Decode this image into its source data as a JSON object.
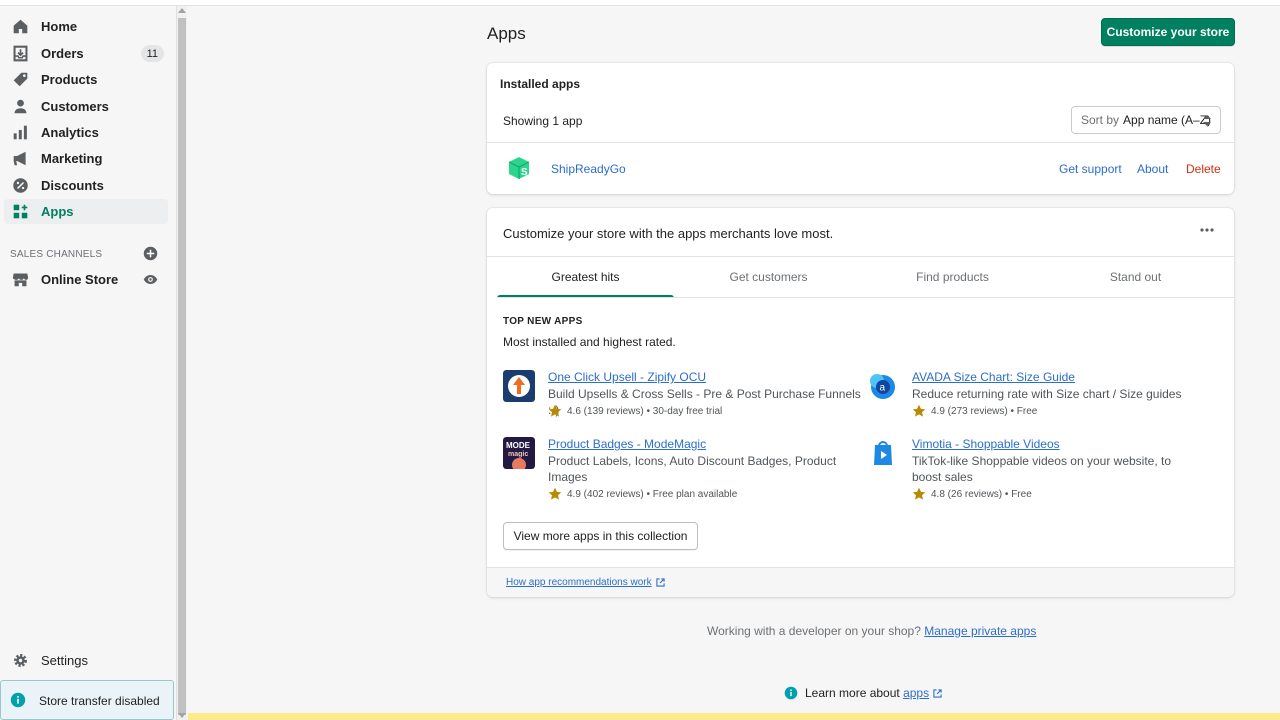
{
  "sidebar": {
    "items": [
      {
        "label": "Home",
        "icon": "home-icon"
      },
      {
        "label": "Orders",
        "icon": "orders-icon",
        "badge": "11"
      },
      {
        "label": "Products",
        "icon": "tag-icon"
      },
      {
        "label": "Customers",
        "icon": "person-icon"
      },
      {
        "label": "Analytics",
        "icon": "bar-chart-icon"
      },
      {
        "label": "Marketing",
        "icon": "megaphone-icon"
      },
      {
        "label": "Discounts",
        "icon": "discount-icon"
      },
      {
        "label": "Apps",
        "icon": "apps-icon",
        "active": true
      }
    ],
    "sales_channels_title": "SALES CHANNELS",
    "online_store": "Online Store",
    "settings": "Settings",
    "store_transfer": "Store transfer disabled"
  },
  "main": {
    "title": "Apps",
    "customize_button": "Customize your store",
    "installed": {
      "title": "Installed apps",
      "showing": "Showing 1 app",
      "sort_prefix": "Sort by",
      "sort_value": "App name (A–Z)",
      "app_name": "ShipReadyGo",
      "get_support": "Get support",
      "about": "About",
      "delete": "Delete"
    },
    "recommend": {
      "heading": "Customize your store with the apps merchants love most.",
      "tabs": [
        "Greatest hits",
        "Get customers",
        "Find products",
        "Stand out"
      ],
      "active_tab": "Greatest hits",
      "section_caps": "TOP NEW APPS",
      "section_sub": "Most installed and highest rated.",
      "apps": [
        {
          "name": "One Click Upsell ‑ Zipify OCU",
          "desc": "Build Upsells & Cross Sells - Pre & Post Purchase Funnels :-)",
          "rating": "4.6 (139 reviews) • 30-day free trial"
        },
        {
          "name": "AVADA Size Chart: Size Guide",
          "desc": "Reduce returning rate with Size chart / Size guides",
          "rating": "4.9 (273 reviews) • Free"
        },
        {
          "name": "Product Badges ‑ ModeMagic",
          "desc": "Product Labels, Icons, Auto Discount Badges, Product Images",
          "rating": "4.9 (402 reviews) • Free plan available"
        },
        {
          "name": "Vimotia ‑ Shoppable Videos",
          "desc": "TikTok-like Shoppable videos on your website, to boost sales",
          "rating": "4.8 (26 reviews) • Free"
        }
      ],
      "view_more": "View more apps in this collection",
      "footer_link": "How app recommendations work"
    },
    "developer_text": "Working with a developer on your shop?",
    "developer_link": "Manage private apps",
    "learn_text": "Learn more about",
    "learn_link": "apps"
  },
  "colors": {
    "accent": "#008060",
    "link": "#2c6ecb",
    "danger": "#d72c0d"
  }
}
